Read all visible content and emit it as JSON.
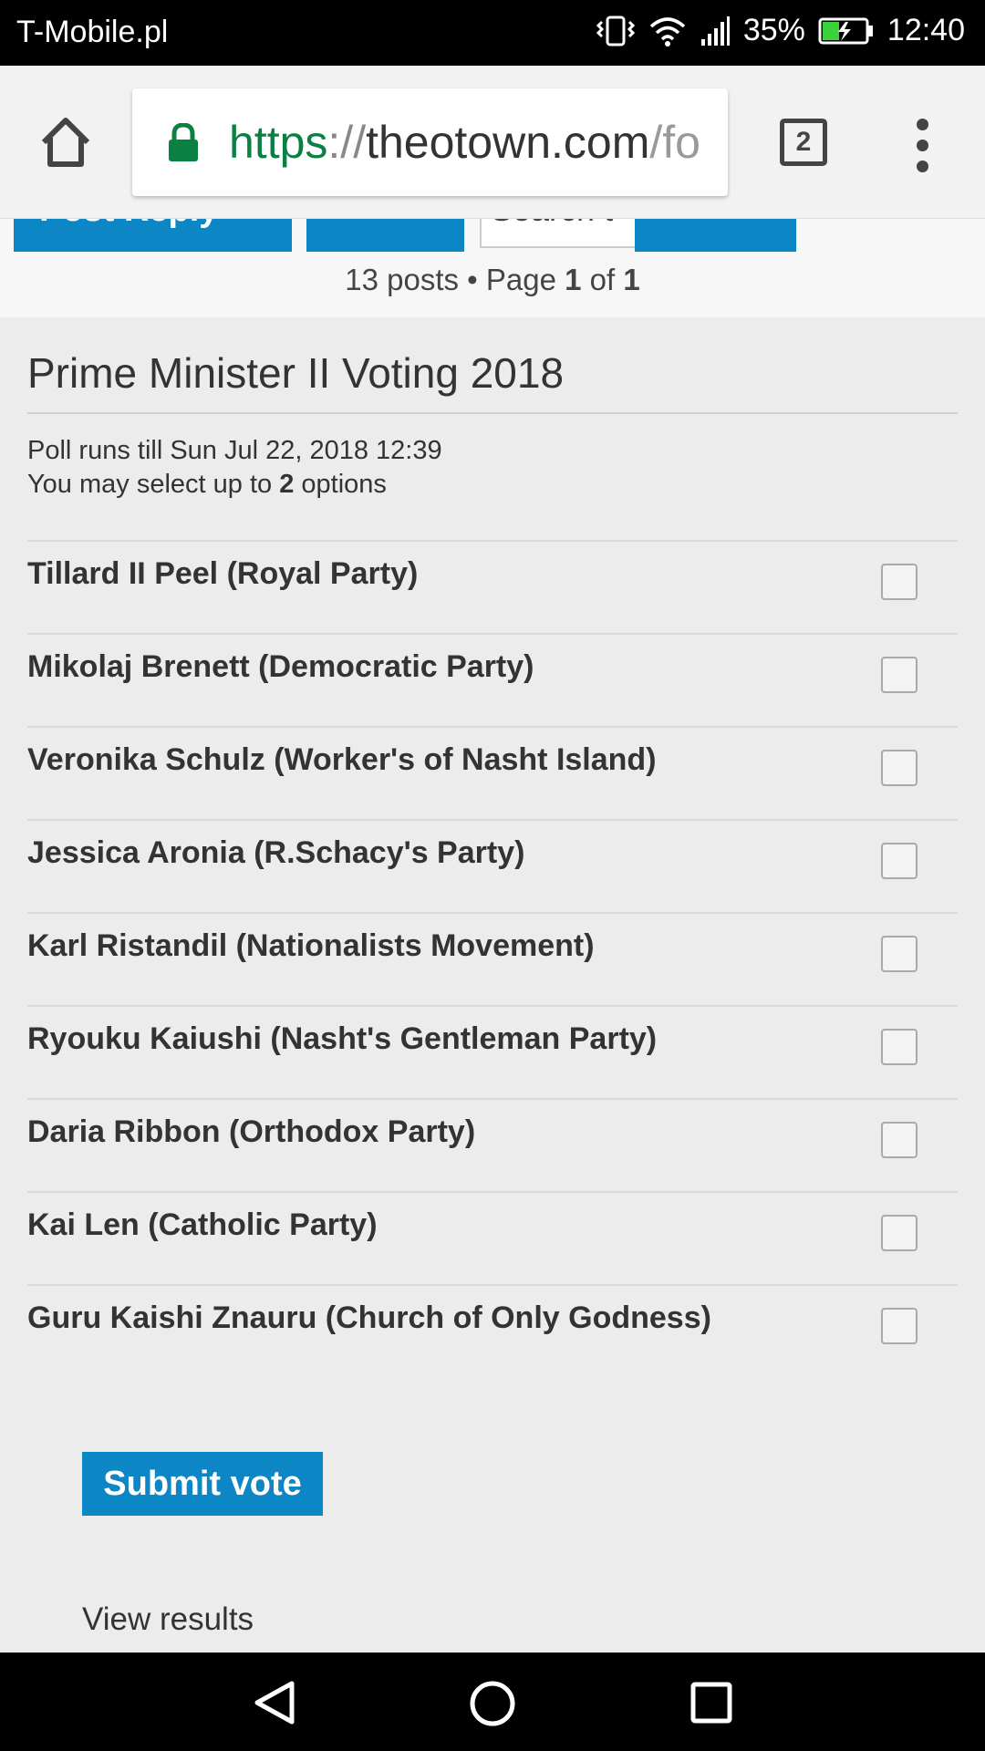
{
  "status_bar": {
    "carrier": "T-Mobile.pl",
    "battery": "35%",
    "time": "12:40",
    "icons": [
      "vibrate-icon",
      "wifi-icon",
      "signal-icon",
      "battery-charging-icon"
    ]
  },
  "browser": {
    "url_scheme": "https",
    "url_separator": "://",
    "url_host": "theotown.com",
    "url_rest": "/fo",
    "tab_count": "2",
    "accent_color": "#0b8043"
  },
  "topic_bar": {
    "post_reply_label": "Post Reply",
    "search_placeholder": "Search t",
    "pagination": {
      "posts": "13 posts • Page ",
      "current": "1",
      "of": " of ",
      "total": "1"
    }
  },
  "poll": {
    "title": "Prime Minister II Voting 2018",
    "runs_till": "Poll runs till Sun Jul 22, 2018 12:39",
    "select_prefix": "You may select up to ",
    "select_count": "2",
    "select_suffix": " options",
    "options": [
      "Tillard II Peel (Royal Party)",
      "Mikolaj Brenett (Democratic Party)",
      "Veronika Schulz (Worker's of Nasht Island)",
      "Jessica Aronia (R.Schacy's Party)",
      "Karl Ristandil (Nationalists Movement)",
      "Ryouku Kaiushi (Nasht's Gentleman Party)",
      "Daria Ribbon (Orthodox Party)",
      "Kai Len (Catholic Party)",
      "Guru Kaishi Znauru (Church of Only Godness)"
    ],
    "submit_label": "Submit vote",
    "view_results_label": "View results",
    "button_color": "#0d86c6"
  }
}
